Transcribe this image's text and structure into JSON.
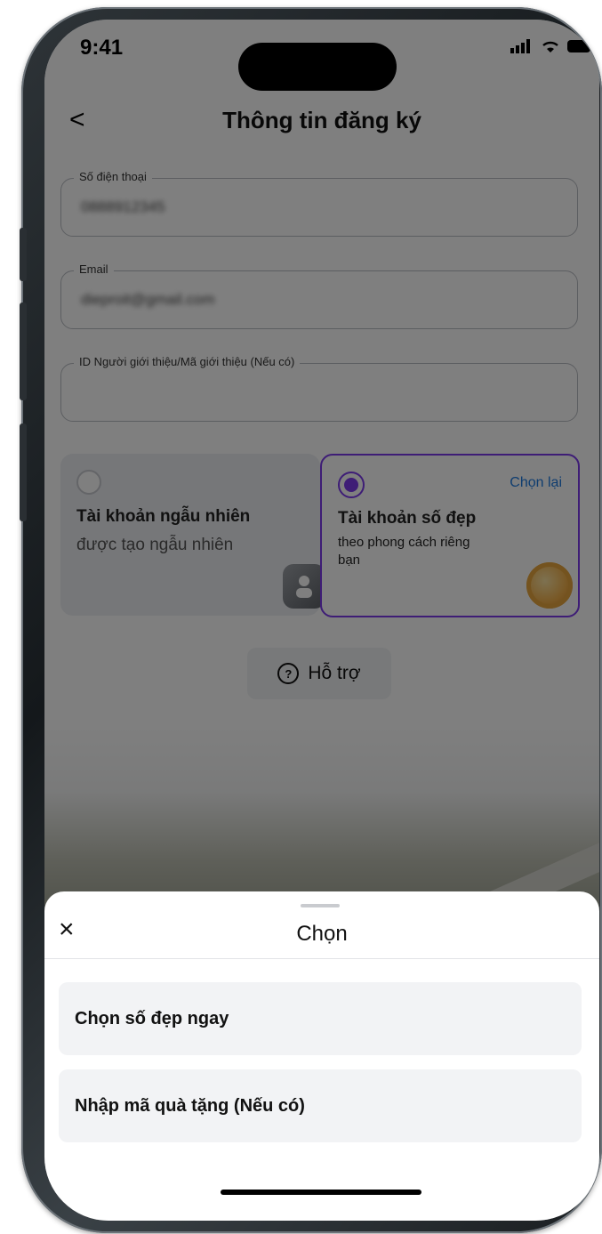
{
  "status_bar": {
    "time": "9:41"
  },
  "header": {
    "back": "<",
    "title": "Thông tin đăng ký"
  },
  "form": {
    "phone": {
      "label": "Số điện thoại",
      "value": "0888912345"
    },
    "email": {
      "label": "Email",
      "value": "dieproit@gmail.com"
    },
    "referral": {
      "label": "ID Người giới thiệu/Mã giới thiệu (Nếu có)",
      "value": ""
    }
  },
  "account_options": {
    "random": {
      "title": "Tài khoản ngẫu nhiên",
      "subtitle": "được tạo ngẫu nhiên",
      "selected": false
    },
    "vanity": {
      "title": "Tài khoản số đẹp",
      "subtitle": "theo phong cách riêng bạn",
      "reselect": "Chọn lại",
      "selected": true
    },
    "accent_color": "#7c3aed",
    "link_color": "#1e7be0"
  },
  "support": {
    "label": "Hỗ trợ"
  },
  "sheet": {
    "title": "Chọn",
    "close": "×",
    "options": [
      {
        "label": "Chọn số đẹp ngay"
      },
      {
        "label": "Nhập mã quà tặng (Nếu có)"
      }
    ]
  }
}
